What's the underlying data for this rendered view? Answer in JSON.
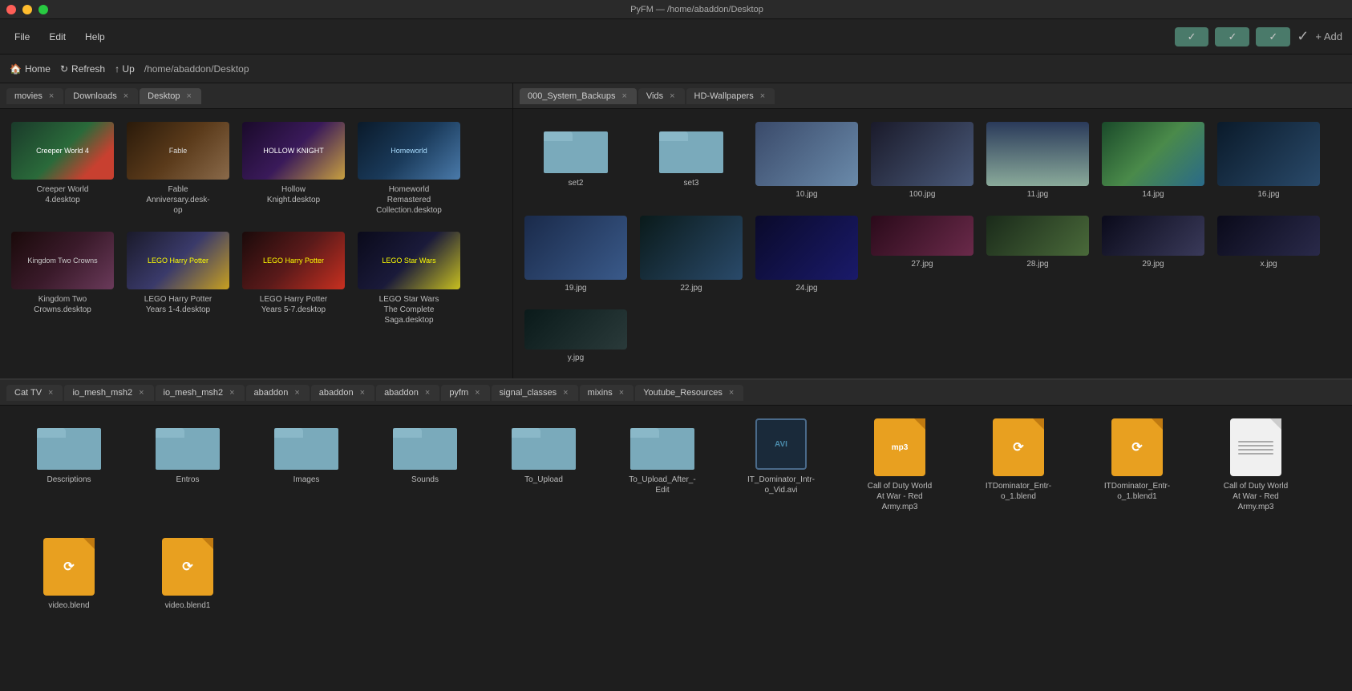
{
  "titlebar": {
    "title": "PyFM — /home/abaddon/Desktop",
    "close": "×",
    "min": "−",
    "max": "□"
  },
  "menubar": {
    "items": [
      "File",
      "Edit",
      "Help"
    ]
  },
  "toolbar": {
    "check_buttons": [
      "✓",
      "✓",
      "✓"
    ],
    "check_single": "✓",
    "add_label": "+ Add"
  },
  "navbar": {
    "home_label": "Home",
    "refresh_label": "Refresh",
    "up_label": "↑ Up",
    "path": "/home/abaddon/Desktop"
  },
  "left_tabs": [
    {
      "label": "movies",
      "active": false
    },
    {
      "label": "Downloads",
      "active": false
    },
    {
      "label": "Desktop",
      "active": true
    }
  ],
  "right_tabs": [
    {
      "label": "000_System_Backups",
      "active": true
    },
    {
      "label": "Vids",
      "active": false
    },
    {
      "label": "HD-Wallpapers",
      "active": false
    }
  ],
  "bottom_tabs": [
    {
      "label": "Cat TV"
    },
    {
      "label": "io_mesh_msh2"
    },
    {
      "label": "io_mesh_msh2"
    },
    {
      "label": "abaddon"
    },
    {
      "label": "abaddon"
    },
    {
      "label": "abaddon"
    },
    {
      "label": "pyfm"
    },
    {
      "label": "signal_classes"
    },
    {
      "label": "mixins"
    },
    {
      "label": "Youtube_Resources"
    }
  ],
  "desktop_files": [
    {
      "name": "Creeper World\n4.desktop",
      "thumb": "creeper"
    },
    {
      "name": "Fable\nAnniversary.desk-\nop",
      "thumb": "fable"
    },
    {
      "name": "Hollow\nKnight.desktop",
      "thumb": "hollow"
    },
    {
      "name": "Homeworld\nRemastered\nCollection.desktop",
      "thumb": "homeworld"
    },
    {
      "name": "Kingdom Two\nCrowns.desktop",
      "thumb": "kingdom"
    },
    {
      "name": "LEGO Harry Potter\nYears 1-4.desktop",
      "thumb": "lego-hp"
    },
    {
      "name": "LEGO Harry Potter\nYears 5-7.desktop",
      "thumb": "lego-hp2"
    },
    {
      "name": "LEGO Star Wars\nThe Complete\nSaga.desktop",
      "thumb": "lego-sw"
    }
  ],
  "wallpapers": [
    {
      "name": "set2",
      "style": "folder"
    },
    {
      "name": "set3",
      "style": "folder"
    },
    {
      "name": "10.jpg",
      "style": "wall-10"
    },
    {
      "name": "100.jpg",
      "style": "wall-100"
    },
    {
      "name": "11.jpg",
      "style": "wall-11"
    },
    {
      "name": "14.jpg",
      "style": "wall-14"
    },
    {
      "name": "16.jpg",
      "style": "wall-16"
    },
    {
      "name": "19.jpg",
      "style": "wall-19"
    },
    {
      "name": "22.jpg",
      "style": "wall-22"
    },
    {
      "name": "24.jpg",
      "style": "wall-24"
    },
    {
      "name": "27.jpg",
      "style": "wall-27"
    },
    {
      "name": "28.jpg",
      "style": "wall-28"
    },
    {
      "name": "29.jpg",
      "style": "wall-29"
    },
    {
      "name": "x.jpg",
      "style": "wall-x"
    },
    {
      "name": "y.jpg",
      "style": "wall-y"
    }
  ],
  "bottom_files": [
    {
      "name": "Descriptions",
      "type": "folder"
    },
    {
      "name": "Entros",
      "type": "folder"
    },
    {
      "name": "Images",
      "type": "folder"
    },
    {
      "name": "Sounds",
      "type": "folder"
    },
    {
      "name": "To_Upload",
      "type": "folder"
    },
    {
      "name": "To_Upload_After_-\nEdit",
      "type": "folder"
    },
    {
      "name": "IT_Dominator_Intr-\no_Vid.avi",
      "type": "avi"
    },
    {
      "name": "Call of Duty World\nAt War - Red\nArmy.mp3",
      "type": "mp3"
    },
    {
      "name": "ITDominator_Entr-\no_1.blend",
      "type": "blend"
    },
    {
      "name": "ITDominator_Entr-\no_1.blend1",
      "type": "blend"
    },
    {
      "name": "video.blend",
      "type": "blend"
    },
    {
      "name": "video.blend1",
      "type": "blend"
    }
  ]
}
